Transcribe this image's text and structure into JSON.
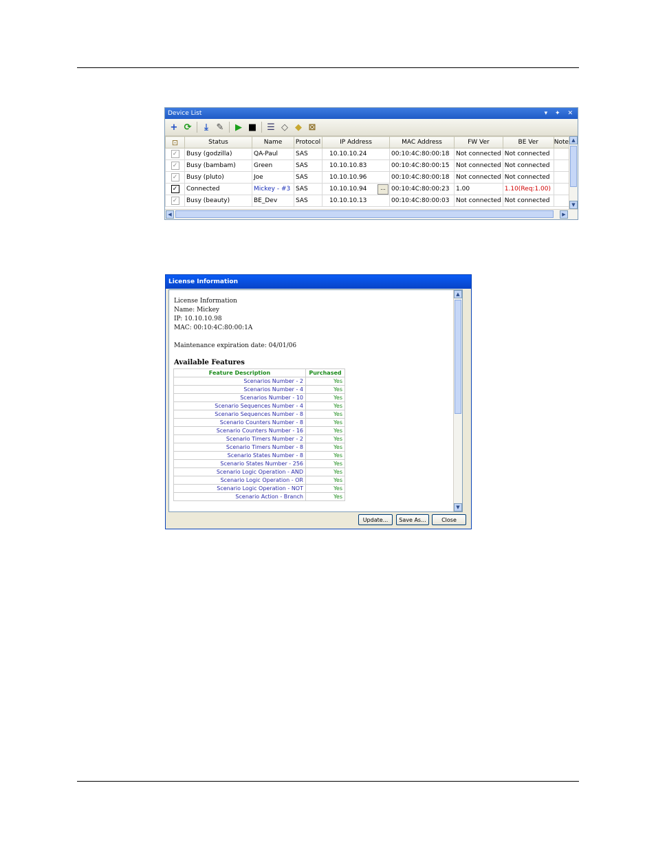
{
  "device_list": {
    "title": "Device List",
    "title_buttons": "▾ ✦ ✕",
    "toolbar": [
      {
        "name": "add-icon",
        "glyph": "+",
        "color": "#1a49c4"
      },
      {
        "name": "refresh-icon",
        "glyph": "⟳",
        "color": "#1a9a1a"
      },
      {
        "name": "download-icon",
        "glyph": "⤓",
        "color": "#2a5ac8"
      },
      {
        "name": "edit-icon",
        "glyph": "✎",
        "color": "#444444"
      },
      {
        "name": "play-icon",
        "glyph": "▶",
        "color": "#1aa01a"
      },
      {
        "name": "stop-icon",
        "glyph": "■",
        "color": "#000000"
      },
      {
        "name": "list-icon",
        "glyph": "☰",
        "color": "#333366"
      },
      {
        "name": "tag-icon",
        "glyph": "◇",
        "color": "#555555"
      },
      {
        "name": "note-icon",
        "glyph": "◆",
        "color": "#c8a830"
      },
      {
        "name": "lock-icon",
        "glyph": "⊠",
        "color": "#8a6a20"
      }
    ],
    "lock_header_glyph": "⊡",
    "columns": [
      "Status",
      "Name",
      "Protocol",
      "IP Address",
      "MAC Address",
      "FW Ver",
      "BE Ver",
      "Notes"
    ],
    "rows": [
      {
        "checked": false,
        "status": "Busy (godzilla)",
        "name": "QA-Paul",
        "protocol": "SAS",
        "ip": "10.10.10.24",
        "mac": "00:10:4C:80:00:18",
        "fw": "Not connected",
        "be": "Not connected",
        "notes": ""
      },
      {
        "checked": false,
        "status": "Busy (bambam)",
        "name": "Green",
        "protocol": "SAS",
        "ip": "10.10.10.83",
        "mac": "00:10:4C:80:00:15",
        "fw": "Not connected",
        "be": "Not connected",
        "notes": ""
      },
      {
        "checked": false,
        "status": "Busy (pluto)",
        "name": "Joe",
        "protocol": "SAS",
        "ip": "10.10.10.96",
        "mac": "00:10:4C:80:00:18",
        "fw": "Not connected",
        "be": "Not connected",
        "notes": ""
      },
      {
        "checked": true,
        "status": "Connected",
        "name": "Mickey - #3",
        "protocol": "SAS",
        "ip": "10.10.10.94",
        "mac": "00:10:4C:80:00:23",
        "fw": "1.00",
        "be": "1.10(Req:1.00)",
        "notes": ""
      },
      {
        "checked": false,
        "status": "Busy (beauty)",
        "name": "BE_Dev",
        "protocol": "SAS",
        "ip": "10.10.10.13",
        "mac": "00:10:4C:80:00:03",
        "fw": "Not connected",
        "be": "Not connected",
        "notes": ""
      }
    ],
    "ellipsis_label": "...",
    "check_glyph": "✓",
    "scroll": {
      "up": "▲",
      "down": "▼",
      "left": "◀",
      "right": "▶"
    },
    "colors": {
      "link": "#1a2fb8",
      "error": "#d00000"
    }
  },
  "license_dialog": {
    "title": "License Information",
    "info_lines": [
      "License Information",
      "Name: Mickey",
      "IP: 10.10.10.98",
      "MAC: 00:10:4C:80:00:1A"
    ],
    "maintenance": "Maintenance expiration date: 04/01/06",
    "features_heading": "Available Features",
    "feature_columns": [
      "Feature Description",
      "Purchased"
    ],
    "features": [
      {
        "desc": "Scenarios Number - 2",
        "purchased": "Yes"
      },
      {
        "desc": "Scenarios Number - 4",
        "purchased": "Yes"
      },
      {
        "desc": "Scenarios Number - 10",
        "purchased": "Yes"
      },
      {
        "desc": "Scenario Sequences Number - 4",
        "purchased": "Yes"
      },
      {
        "desc": "Scenario Sequences Number - 8",
        "purchased": "Yes"
      },
      {
        "desc": "Scenario Counters Number - 8",
        "purchased": "Yes"
      },
      {
        "desc": "Scenario Counters Number - 16",
        "purchased": "Yes"
      },
      {
        "desc": "Scenario Timers Number - 2",
        "purchased": "Yes"
      },
      {
        "desc": "Scenario Timers Number - 8",
        "purchased": "Yes"
      },
      {
        "desc": "Scenario States Number - 8",
        "purchased": "Yes"
      },
      {
        "desc": "Scenario States Number - 256",
        "purchased": "Yes"
      },
      {
        "desc": "Scenario Logic Operation - AND",
        "purchased": "Yes"
      },
      {
        "desc": "Scenario Logic Operation - OR",
        "purchased": "Yes"
      },
      {
        "desc": "Scenario Logic Operation - NOT",
        "purchased": "Yes"
      },
      {
        "desc": "Scenario Action - Branch",
        "purchased": "Yes"
      }
    ],
    "buttons": {
      "update": "Update...",
      "save_as": "Save As...",
      "close": "Close"
    },
    "scroll": {
      "up": "▲",
      "down": "▼"
    }
  }
}
